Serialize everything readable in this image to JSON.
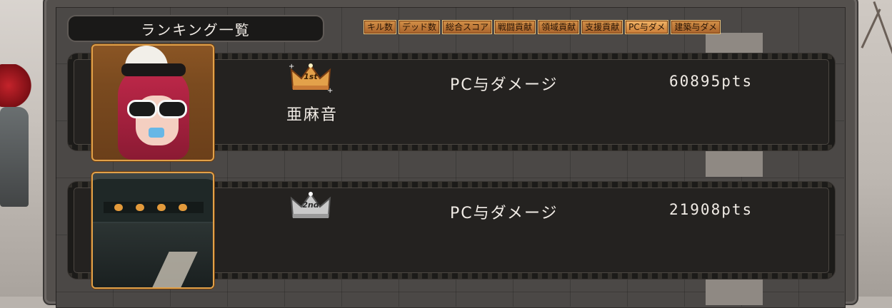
{
  "window": {
    "title": "ランキング一覧"
  },
  "tabs": [
    {
      "label": "キル数"
    },
    {
      "label": "デッド数"
    },
    {
      "label": "総合スコア"
    },
    {
      "label": "戦闘貢献"
    },
    {
      "label": "領域貢献"
    },
    {
      "label": "支援貢献"
    },
    {
      "label": "PC与ダメ"
    },
    {
      "label": "建築与ダメ"
    }
  ],
  "active_tab_index": 6,
  "rankings": [
    {
      "rank_label": "1st",
      "player_name": "亜麻音",
      "category": "PC与ダメージ",
      "score": "60895pts",
      "badge_color": "#e3a14a"
    },
    {
      "rank_label": "2nd",
      "player_name": "",
      "category": "PC与ダメージ",
      "score": "21908pts",
      "badge_color": "#c9c9c9"
    }
  ],
  "colors": {
    "panel_bg": "#4b4846",
    "row_bg": "#242220",
    "tab_orange": "#c97b36",
    "portrait_border": "#e1a14a"
  }
}
